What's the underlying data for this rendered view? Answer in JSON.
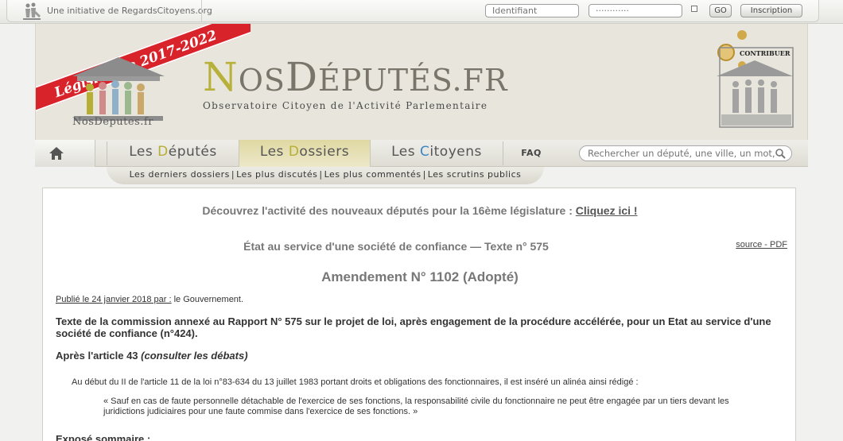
{
  "topbar": {
    "initiative": "Une initiative de RegardsCitoyens.org",
    "id_placeholder": "Identifiant",
    "pw_placeholder": "············",
    "go_label": "GO",
    "inscription_label": "Inscription"
  },
  "header": {
    "banner": "Législature 2017-2022",
    "logo_text": "NosDeputes.fr",
    "title_parts": [
      "N",
      "OS",
      "D",
      "ÉPUTÉS",
      ".FR"
    ],
    "subtitle": "Observatoire Citoyen de l'Activité Parlementaire",
    "contribuer": "CONTRIBUER"
  },
  "nav": {
    "home_icon": "home-icon",
    "deputes": {
      "cap": "D",
      "rest": "éputés",
      "prefix": "Les "
    },
    "dossiers": {
      "cap": "D",
      "rest": "ossiers",
      "prefix": "Les "
    },
    "citoyens": {
      "cap": "C",
      "rest": "itoyens",
      "prefix": "Les "
    },
    "faq": "FAQ",
    "search_placeholder": "Rechercher un député, une ville, un mot, ...",
    "search_icon": "search-icon",
    "subnav": [
      "Les derniers dossiers",
      "Les plus discutés",
      "Les plus commentés",
      "Les scrutins publics"
    ]
  },
  "content": {
    "announce_text": "Découvrez l'activité des nouveaux députés pour la 16ème législature : ",
    "announce_link": "Cliquez ici !",
    "doc_title": "État au service d'une société de confiance — Texte n° 575",
    "source": "source - PDF",
    "amendement": "Amendement N° 1102 (Adopté)",
    "pub_label": "Publié le 24 janvier 2018 par :",
    "pub_author": " le Gouvernement.",
    "texte": "Texte de la commission annexé au Rapport N° 575 sur le projet de loi, après engagement de la procédure accélérée, pour un Etat au service d'une société de confiance (n°424).",
    "apres_label": "Après l'article 43 ",
    "apres_link": "(consulter les débats)",
    "dispositif": "Au début du II de l'article 11 de la loi n°83-634 du 13 juillet 1983 portant droits et obligations des fonctionnaires, il est inséré un alinéa ainsi rédigé :",
    "quote": "« Sauf en cas de faute personnelle détachable de l'exercice de ses fonctions, la responsabilité civile du fonctionnaire ne peut être engagée par un tiers devant les juridictions judiciaires pour une faute commise dans l'exercice de ses fonctions. »",
    "expose": "Exposé sommaire :"
  },
  "colors": {
    "accent_gold": "#b6ae35",
    "accent_blue": "#3a86c6",
    "banner_red": "#d9232a"
  }
}
